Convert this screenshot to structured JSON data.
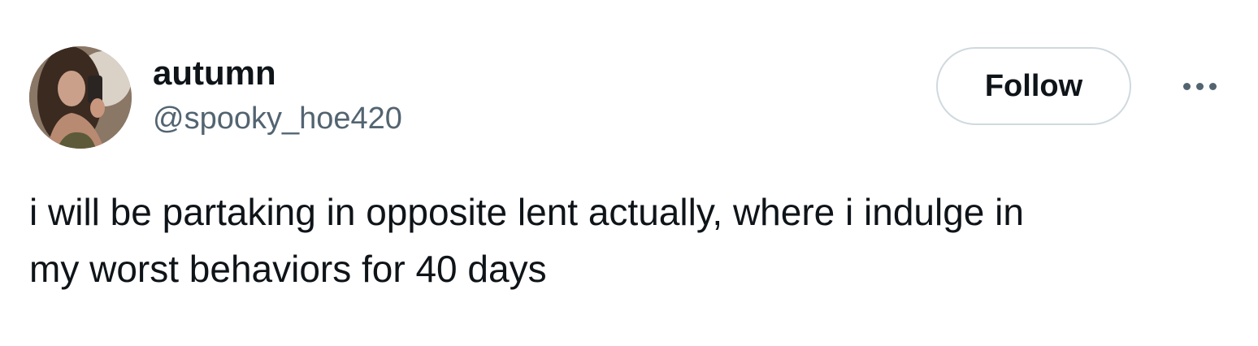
{
  "author": {
    "display_name": "autumn",
    "handle": "@spooky_hoe420",
    "avatar_alt": "profile photo"
  },
  "actions": {
    "follow_label": "Follow",
    "more_icon": "more-horizontal-icon"
  },
  "tweet": {
    "text": "i will be partaking in opposite lent actually, where i indulge in\nmy worst behaviors for 40 days"
  },
  "colors": {
    "text_primary": "#0f1419",
    "text_secondary": "#536471",
    "button_border": "#cfd9de",
    "background": "#ffffff"
  }
}
